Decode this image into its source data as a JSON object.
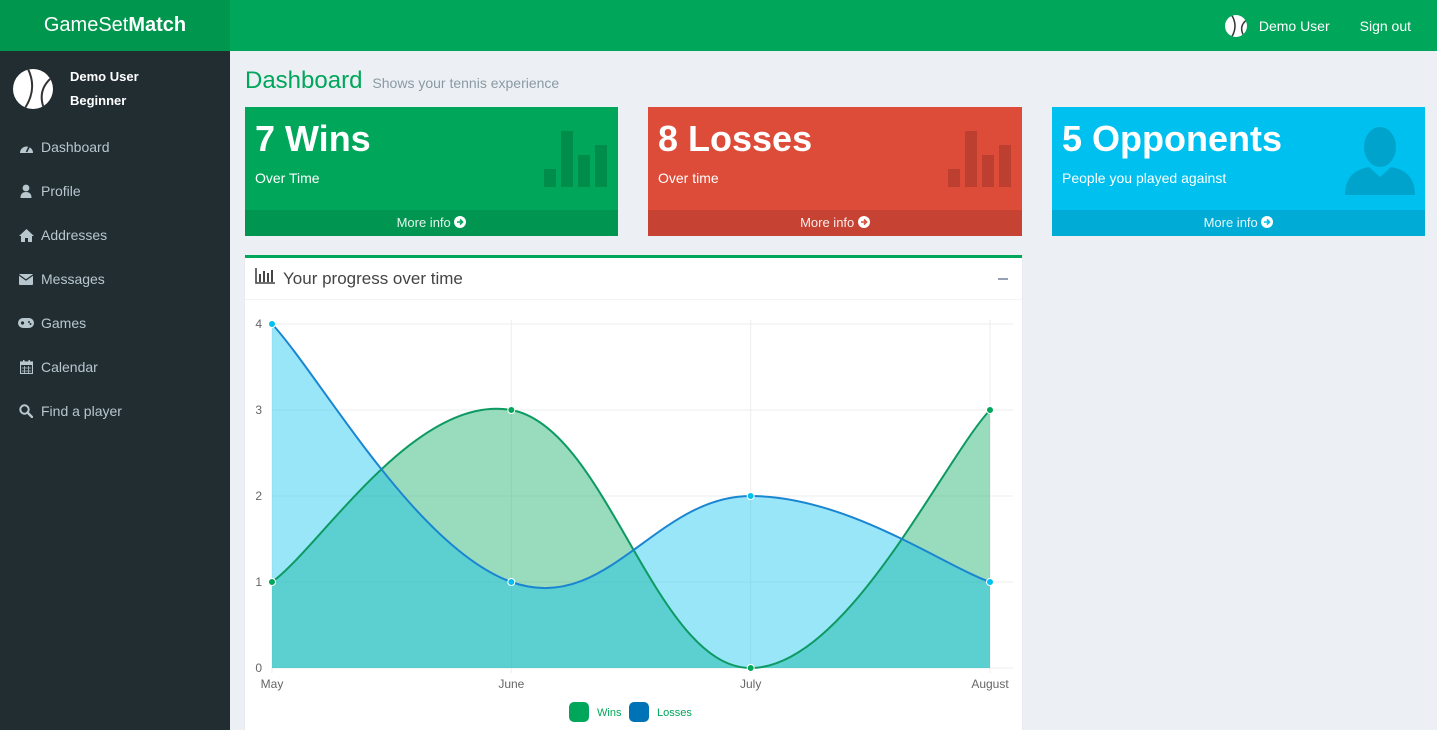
{
  "brand": {
    "light": "GameSet",
    "bold": "Match"
  },
  "topbar": {
    "user_name": "Demo User",
    "signout": "Sign out"
  },
  "sidebar": {
    "user_name": "Demo User",
    "user_level": "Beginner",
    "items": [
      {
        "label": "Dashboard",
        "icon": "dashboard-icon"
      },
      {
        "label": "Profile",
        "icon": "user-icon"
      },
      {
        "label": "Addresses",
        "icon": "home-icon"
      },
      {
        "label": "Messages",
        "icon": "envelope-icon"
      },
      {
        "label": "Games",
        "icon": "gamepad-icon"
      },
      {
        "label": "Calendar",
        "icon": "calendar-icon"
      },
      {
        "label": "Find a player",
        "icon": "search-icon"
      }
    ]
  },
  "page": {
    "title": "Dashboard",
    "subtitle": "Shows your tennis experience"
  },
  "stats": [
    {
      "value": "7 Wins",
      "label": "Over Time",
      "more": "More info",
      "color": "#00a65a",
      "icon": "bar-chart-icon"
    },
    {
      "value": "8 Losses",
      "label": "Over time",
      "more": "More info",
      "color": "#dd4b39",
      "icon": "bar-chart-icon"
    },
    {
      "value": "5 Opponents",
      "label": "People you played against",
      "more": "More info",
      "color": "#00c0ef",
      "icon": "person-icon"
    }
  ],
  "progress": {
    "title": "Your progress over time"
  },
  "chart_data": {
    "type": "area",
    "categories": [
      "May",
      "June",
      "July",
      "August"
    ],
    "ylim": [
      0,
      4
    ],
    "yticks": [
      0,
      1,
      2,
      3,
      4
    ],
    "grid": true,
    "legend": "bottom",
    "series": [
      {
        "name": "Wins",
        "values": [
          1,
          3,
          0,
          3
        ],
        "color": "#00a65a"
      },
      {
        "name": "Losses",
        "values": [
          4,
          1,
          2,
          1
        ],
        "color": "#0073b7"
      }
    ]
  }
}
